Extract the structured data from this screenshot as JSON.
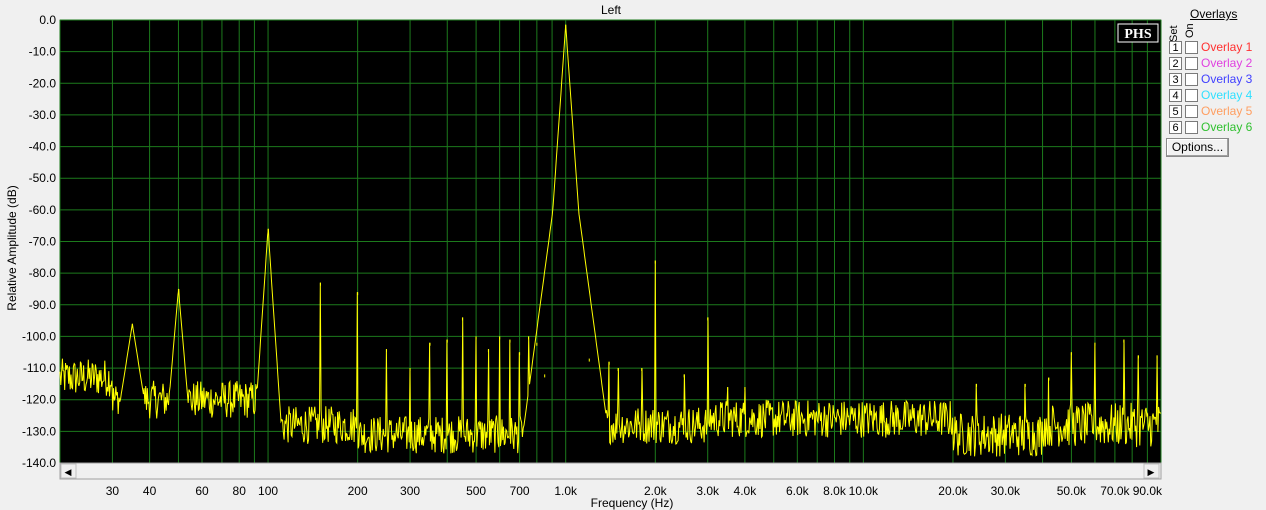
{
  "chart_data": {
    "type": "line",
    "title": "Left",
    "xlabel": "Frequency (Hz)",
    "ylabel": "Relative Amplitude (dB)",
    "xscale": "log",
    "xlim": [
      20,
      100000
    ],
    "ylim": [
      -140,
      0
    ],
    "grid": true,
    "background": "#000000",
    "grid_color": "#1c7a1c",
    "line_color": "#ffff00",
    "y_ticks": [
      "0.0",
      "-10.0",
      "-20.0",
      "-30.0",
      "-40.0",
      "-50.0",
      "-60.0",
      "-70.0",
      "-80.0",
      "-90.0",
      "-100.0",
      "-110.0",
      "-120.0",
      "-130.0",
      "-140.0"
    ],
    "x_ticks": [
      {
        "v": 30,
        "label": "30"
      },
      {
        "v": 40,
        "label": "40"
      },
      {
        "v": 60,
        "label": "60"
      },
      {
        "v": 80,
        "label": "80"
      },
      {
        "v": 100,
        "label": "100"
      },
      {
        "v": 200,
        "label": "200"
      },
      {
        "v": 300,
        "label": "300"
      },
      {
        "v": 500,
        "label": "500"
      },
      {
        "v": 700,
        "label": "700"
      },
      {
        "v": 1000,
        "label": "1.0k"
      },
      {
        "v": 2000,
        "label": "2.0k"
      },
      {
        "v": 3000,
        "label": "3.0k"
      },
      {
        "v": 4000,
        "label": "4.0k"
      },
      {
        "v": 6000,
        "label": "6.0k"
      },
      {
        "v": 8000,
        "label": "8.0k"
      },
      {
        "v": 10000,
        "label": "10.0k"
      },
      {
        "v": 20000,
        "label": "20.0k"
      },
      {
        "v": 30000,
        "label": "30.0k"
      },
      {
        "v": 50000,
        "label": "50.0k"
      },
      {
        "v": 70000,
        "label": "70.0k"
      },
      {
        "v": 90000,
        "label": "90.0k"
      }
    ],
    "peaks": [
      {
        "f": 1000,
        "db": -1.5
      },
      {
        "f": 100,
        "db": -66
      },
      {
        "f": 50,
        "db": -85
      },
      {
        "f": 35,
        "db": -96
      },
      {
        "f": 150,
        "db": -83
      },
      {
        "f": 200,
        "db": -86
      },
      {
        "f": 2000,
        "db": -76
      },
      {
        "f": 3000,
        "db": -94
      },
      {
        "f": 250,
        "db": -104
      },
      {
        "f": 300,
        "db": -110
      },
      {
        "f": 350,
        "db": -102
      },
      {
        "f": 400,
        "db": -101
      },
      {
        "f": 450,
        "db": -94
      },
      {
        "f": 500,
        "db": -100
      },
      {
        "f": 550,
        "db": -104
      },
      {
        "f": 600,
        "db": -100
      },
      {
        "f": 650,
        "db": -101
      },
      {
        "f": 700,
        "db": -105
      },
      {
        "f": 750,
        "db": -100
      },
      {
        "f": 800,
        "db": -102
      },
      {
        "f": 850,
        "db": -112
      },
      {
        "f": 1200,
        "db": -107
      },
      {
        "f": 1400,
        "db": -108
      },
      {
        "f": 1500,
        "db": -110
      },
      {
        "f": 1800,
        "db": -110
      },
      {
        "f": 2500,
        "db": -112
      },
      {
        "f": 3500,
        "db": -116
      },
      {
        "f": 4000,
        "db": -116
      },
      {
        "f": 24000,
        "db": -115
      },
      {
        "f": 35000,
        "db": -115
      },
      {
        "f": 42000,
        "db": -113
      },
      {
        "f": 50000,
        "db": -105
      },
      {
        "f": 60000,
        "db": -102
      },
      {
        "f": 75000,
        "db": -101
      },
      {
        "f": 84000,
        "db": -106
      },
      {
        "f": 97000,
        "db": -106
      }
    ]
  },
  "panel": {
    "title": "Overlays",
    "set_label": "Set",
    "on_label": "On",
    "overlays": [
      {
        "num": "1",
        "label": "Overlay 1",
        "color": "#ff3030"
      },
      {
        "num": "2",
        "label": "Overlay 2",
        "color": "#e040e0"
      },
      {
        "num": "3",
        "label": "Overlay 3",
        "color": "#4040ff"
      },
      {
        "num": "4",
        "label": "Overlay 4",
        "color": "#30e0ff"
      },
      {
        "num": "5",
        "label": "Overlay 5",
        "color": "#ff9e60"
      },
      {
        "num": "6",
        "label": "Overlay 6",
        "color": "#30c030"
      }
    ],
    "options_label": "Options..."
  },
  "logo": "PHS",
  "scroll": {
    "left_arrow": "◀",
    "right_arrow": "▶"
  }
}
